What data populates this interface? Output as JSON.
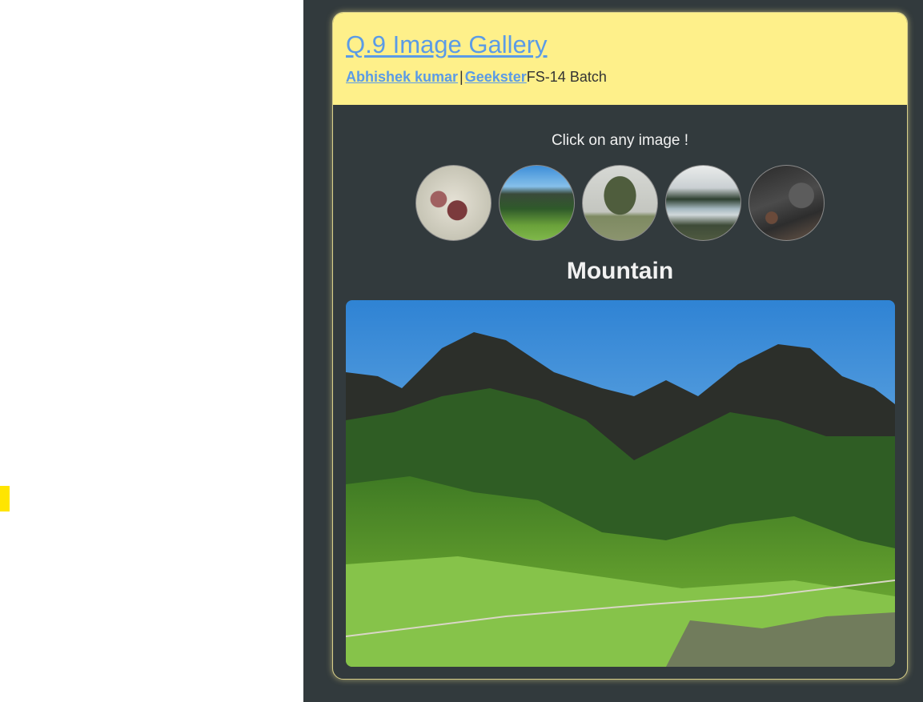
{
  "header": {
    "title": "Q.9 Image Gallery",
    "author_link": "Abhishek kumar",
    "separator": "|",
    "org_link": "Geekster",
    "batch": "FS-14 Batch"
  },
  "gallery": {
    "prompt": "Click on any image !",
    "thumbnails": [
      {
        "name": "plum",
        "icon": "plum-thumbnail"
      },
      {
        "name": "mountain",
        "icon": "mountain-thumbnail"
      },
      {
        "name": "tree",
        "icon": "tree-thumbnail"
      },
      {
        "name": "lake",
        "icon": "lake-thumbnail"
      },
      {
        "name": "coal",
        "icon": "coal-thumbnail"
      }
    ],
    "selected_caption": "Mountain"
  },
  "colors": {
    "header_bg": "#fef08a",
    "page_bg": "#323a3d",
    "link": "#5b9be6",
    "marker": "#ffe500"
  }
}
